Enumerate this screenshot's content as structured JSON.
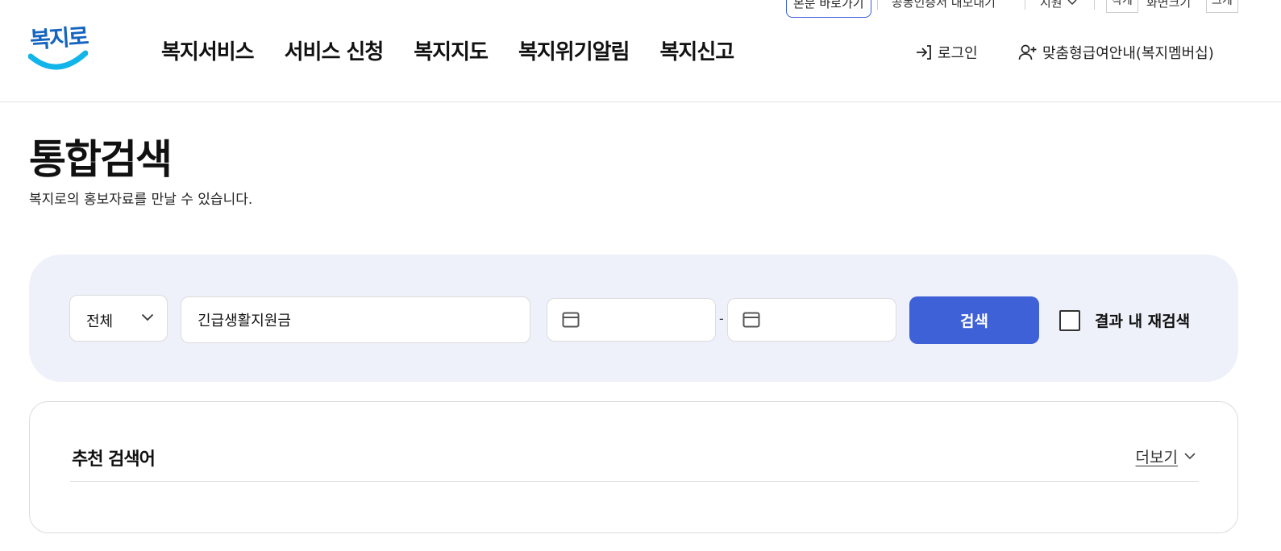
{
  "utility": {
    "skip_link": "본문 바로가기",
    "cert": "공동인증서 내보내기",
    "support": "지원",
    "font_small": "작게",
    "screen_size": "화면크기",
    "font_large": "크게"
  },
  "header": {
    "logo_text": "복지로",
    "nav": [
      "복지서비스",
      "서비스 신청",
      "복지지도",
      "복지위기알림",
      "복지신고"
    ],
    "login": "로그인",
    "membership": "맞춤형급여안내(복지멤버십)"
  },
  "page": {
    "title": "통합검색",
    "description": "복지로의 홍보자료를 만날 수 있습니다."
  },
  "search": {
    "category_selected": "전체",
    "keyword": "긴급생활지원금",
    "date_separator": "-",
    "button": "검색",
    "research_label": "결과 내 재검색",
    "research_checked": false
  },
  "recommend": {
    "title": "추천 검색어",
    "more": "더보기"
  },
  "colors": {
    "primary": "#3f61d7",
    "panel_bg": "#eef1fa",
    "logo_blue": "#1565c0",
    "logo_smile": "#12b5ea"
  }
}
